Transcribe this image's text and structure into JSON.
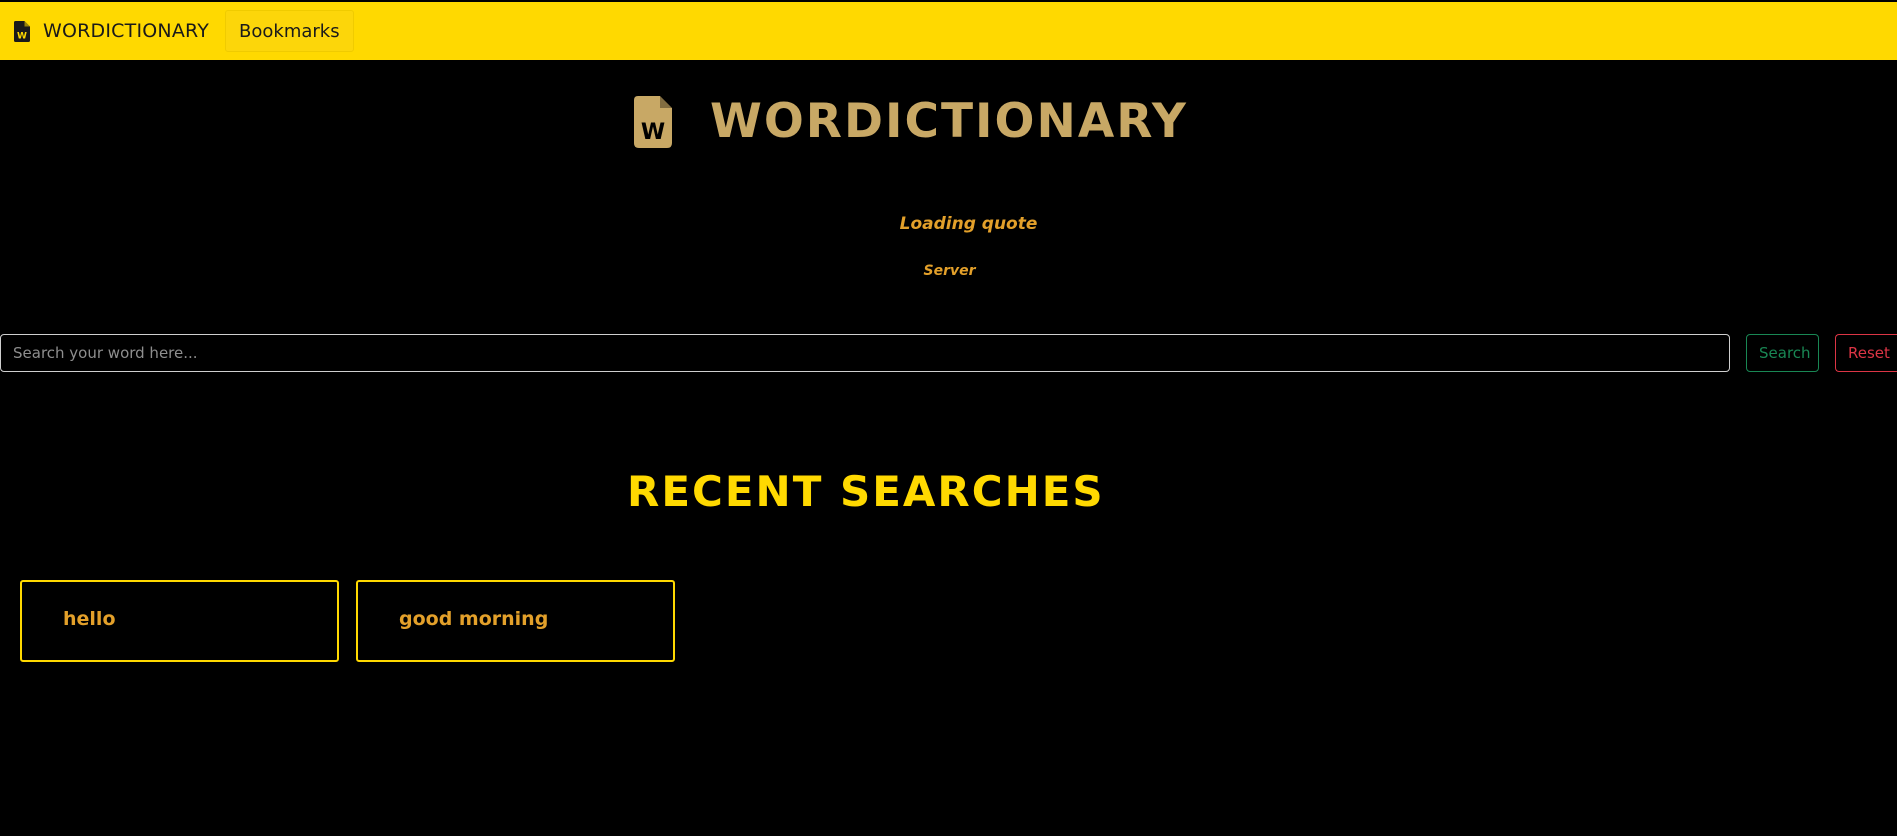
{
  "colors": {
    "navbar_bg": "#ffd900",
    "page_bg": "#000000",
    "hero_gold": "#c8a865",
    "accent_yellow": "#ffd900",
    "quote_orange": "#e3a02a",
    "search_green": "#198754",
    "reset_red": "#dc3545"
  },
  "navbar": {
    "brand_icon": "file-word-icon",
    "brand_label": "WORDICTIONARY",
    "links": [
      {
        "label": "Bookmarks"
      }
    ]
  },
  "hero": {
    "icon": "file-word-icon",
    "title": "WORDICTIONARY"
  },
  "quote": {
    "text": "Loading quote",
    "author": "Server"
  },
  "search": {
    "placeholder": "Search your word here...",
    "value": "",
    "search_label": "Search",
    "reset_label": "Reset"
  },
  "recent": {
    "title": "RECENT SEARCHES",
    "items": [
      {
        "word": "hello"
      },
      {
        "word": "good morning"
      }
    ]
  }
}
